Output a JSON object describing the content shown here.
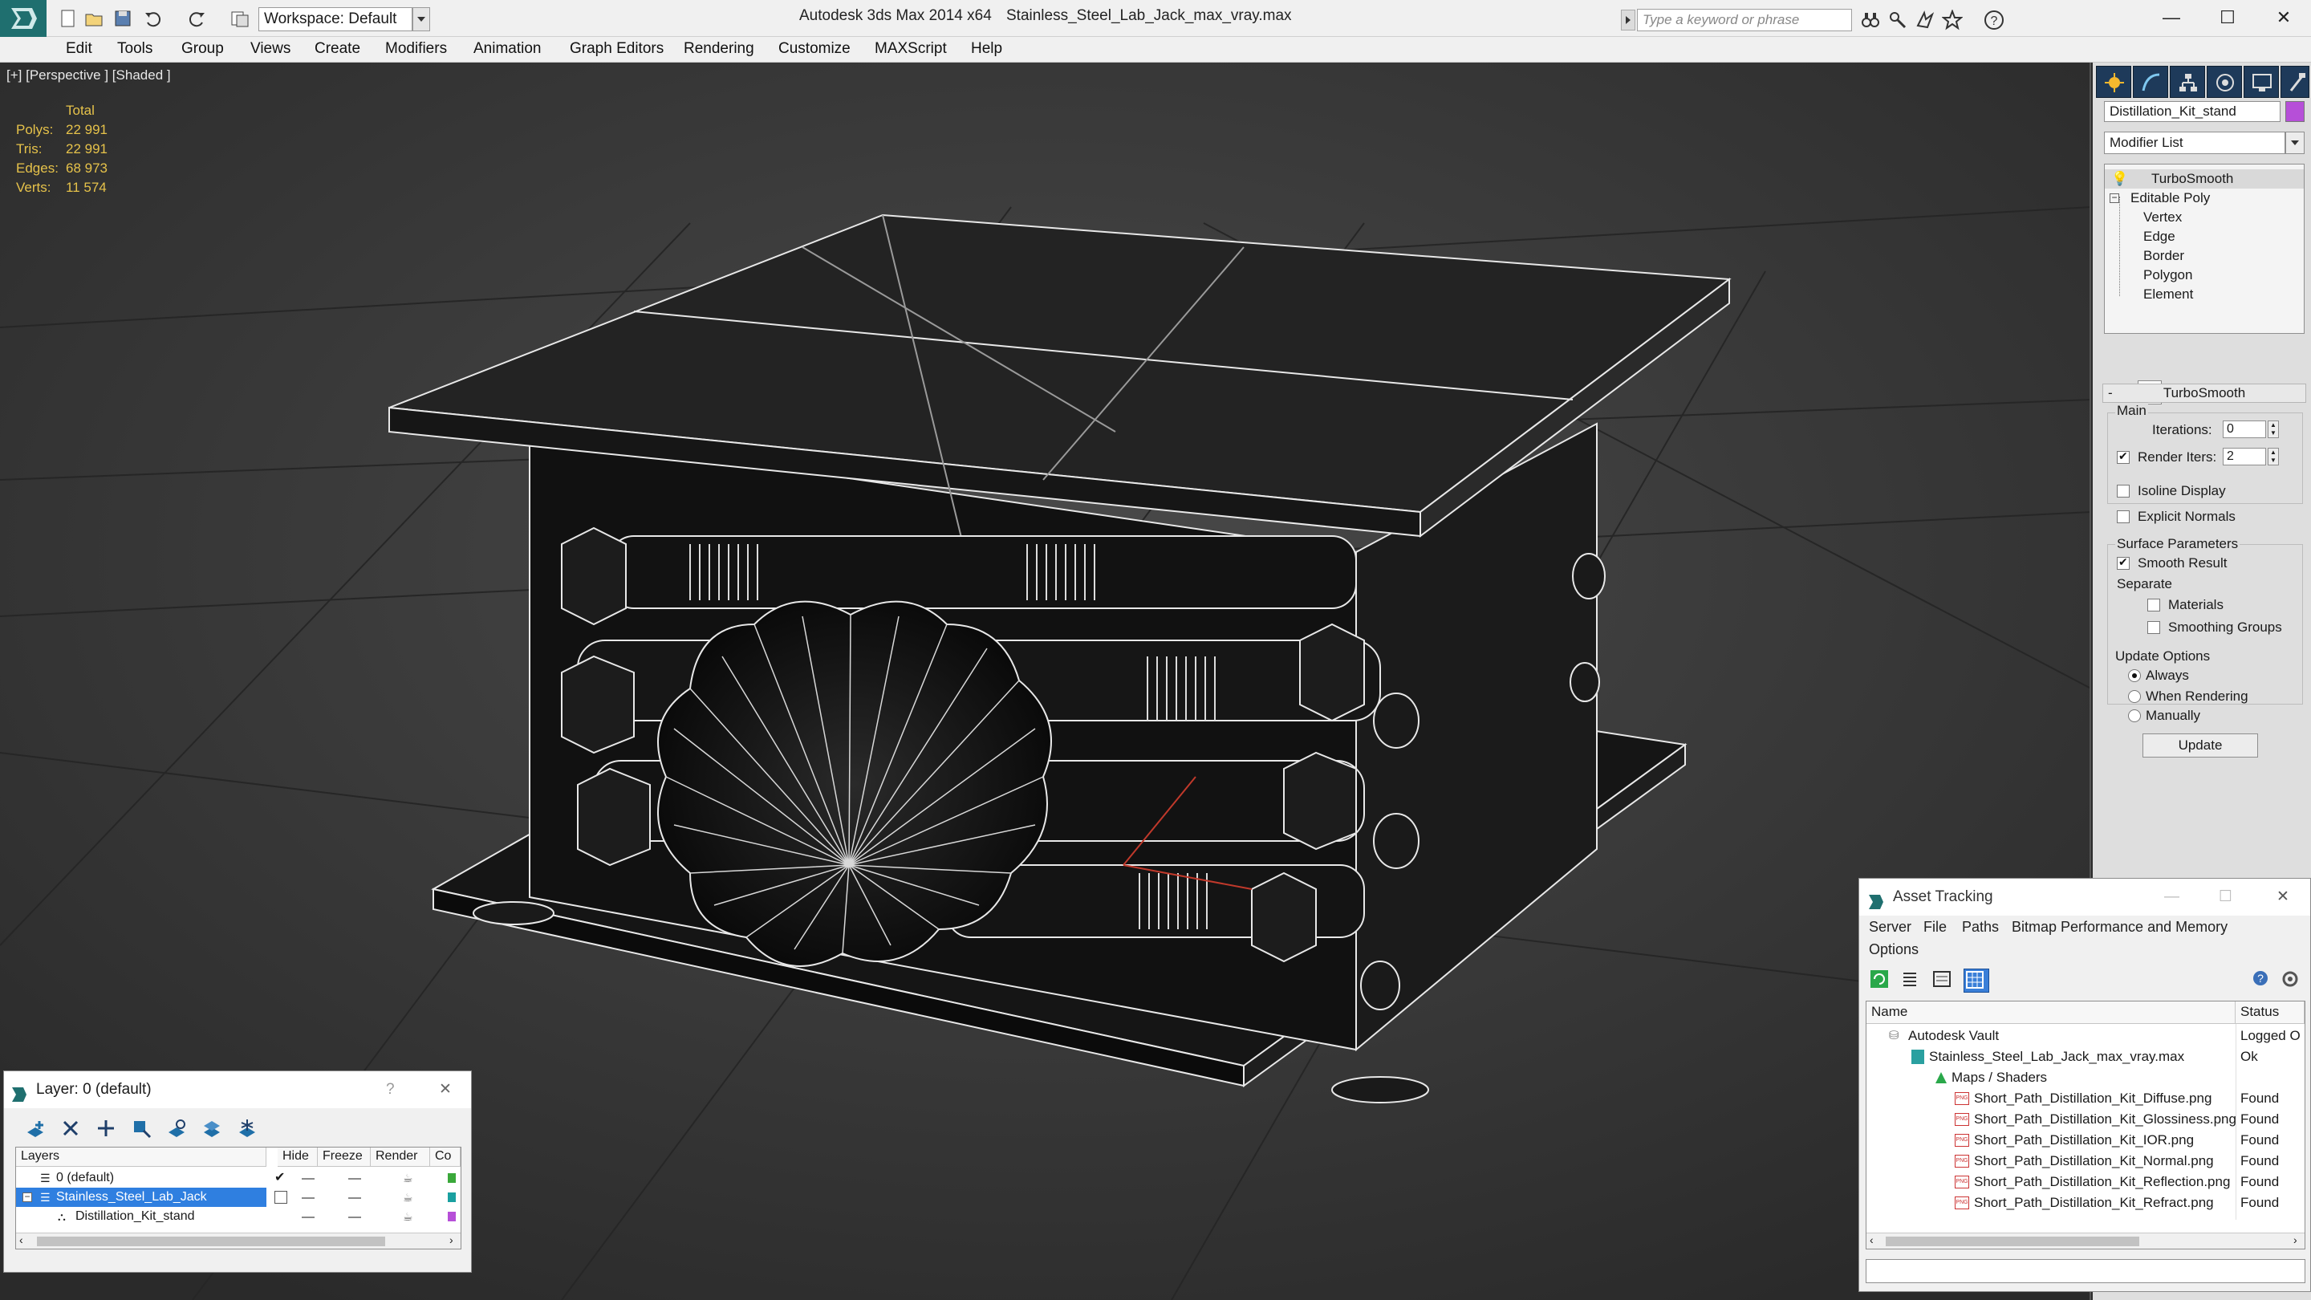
{
  "titlebar": {
    "workspace": "Workspace: Default",
    "app_title": "Autodesk 3ds Max  2014 x64",
    "file_title": "Stainless_Steel_Lab_Jack_max_vray.max",
    "search_placeholder": "Type a keyword or phrase",
    "window_controls": {
      "minimize": "—",
      "maximize": "☐",
      "close": "✕"
    }
  },
  "menu": [
    "Edit",
    "Tools",
    "Group",
    "Views",
    "Create",
    "Modifiers",
    "Animation",
    "Graph Editors",
    "Rendering",
    "Customize",
    "MAXScript",
    "Help"
  ],
  "viewport": {
    "label": "[+] [Perspective ] [Shaded ]",
    "stats": {
      "total_label": "Total",
      "rows": [
        {
          "label": "Polys:",
          "value": "22 991"
        },
        {
          "label": "Tris:",
          "value": "22 991"
        },
        {
          "label": "Edges:",
          "value": "68 973"
        },
        {
          "label": "Verts:",
          "value": "11 574"
        }
      ]
    }
  },
  "command_panel": {
    "object_name": "Distillation_Kit_stand",
    "object_color": "#b64fd8",
    "modifier_list": "Modifier List",
    "stack": [
      {
        "label": "TurboSmooth",
        "indent": 0
      },
      {
        "label": "Editable Poly",
        "indent": 0
      },
      {
        "label": "Vertex",
        "indent": 1
      },
      {
        "label": "Edge",
        "indent": 1
      },
      {
        "label": "Border",
        "indent": 1
      },
      {
        "label": "Polygon",
        "indent": 1
      },
      {
        "label": "Element",
        "indent": 1
      }
    ],
    "turbosmooth": {
      "header": "TurboSmooth",
      "main": "Main",
      "iterations_label": "Iterations:",
      "iterations_value": "0",
      "render_iters_label": "Render Iters:",
      "render_iters_value": "2",
      "isoline": "Isoline Display",
      "explicit_normals": "Explicit Normals",
      "surface_params": "Surface Parameters",
      "smooth_result": "Smooth Result",
      "separate": "Separate",
      "materials": "Materials",
      "smoothing_groups": "Smoothing Groups",
      "update_options": "Update Options",
      "always": "Always",
      "when_rendering": "When Rendering",
      "manually": "Manually",
      "update_button": "Update"
    }
  },
  "layer_dialog": {
    "title": "Layer: 0 (default)",
    "help": "?",
    "close": "✕",
    "columns": [
      "Layers",
      "Hide",
      "Freeze",
      "Render",
      "Co"
    ],
    "rows": [
      {
        "name": "0 (default)",
        "selected": false,
        "color": "#3aa83a"
      },
      {
        "name": "Stainless_Steel_Lab_Jack",
        "selected": true,
        "color": "#1aa0a0"
      },
      {
        "name": "Distillation_Kit_stand",
        "selected": false,
        "color": "#b64fd8"
      }
    ]
  },
  "asset_dialog": {
    "title": "Asset Tracking",
    "menus": [
      "Server",
      "File",
      "Paths",
      "Bitmap Performance and Memory",
      "Options"
    ],
    "columns": [
      "Name",
      "Status"
    ],
    "rows": [
      {
        "name": "Autodesk Vault",
        "status": "Logged O",
        "indent": 0
      },
      {
        "name": "Stainless_Steel_Lab_Jack_max_vray.max",
        "status": "Ok",
        "indent": 1
      },
      {
        "name": "Maps / Shaders",
        "status": "",
        "indent": 2
      },
      {
        "name": "Short_Path_Distillation_Kit_Diffuse.png",
        "status": "Found",
        "indent": 3
      },
      {
        "name": "Short_Path_Distillation_Kit_Glossiness.png",
        "status": "Found",
        "indent": 3
      },
      {
        "name": "Short_Path_Distillation_Kit_IOR.png",
        "status": "Found",
        "indent": 3
      },
      {
        "name": "Short_Path_Distillation_Kit_Normal.png",
        "status": "Found",
        "indent": 3
      },
      {
        "name": "Short_Path_Distillation_Kit_Reflection.png",
        "status": "Found",
        "indent": 3
      },
      {
        "name": "Short_Path_Distillation_Kit_Refract.png",
        "status": "Found",
        "indent": 3
      }
    ]
  }
}
